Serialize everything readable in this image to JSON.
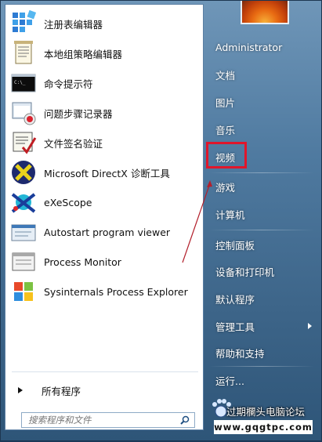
{
  "left_menu": {
    "items": [
      {
        "label": "注册表编辑器",
        "icon": "registry-editor-icon"
      },
      {
        "label": "本地组策略编辑器",
        "icon": "group-policy-icon"
      },
      {
        "label": "命令提示符",
        "icon": "command-prompt-icon"
      },
      {
        "label": "问题步骤记录器",
        "icon": "steps-recorder-icon"
      },
      {
        "label": "文件签名验证",
        "icon": "file-signature-icon"
      },
      {
        "label": "Microsoft DirectX 诊断工具",
        "icon": "directx-icon"
      },
      {
        "label": "eXeScope",
        "icon": "exescope-icon"
      },
      {
        "label": "Autostart program viewer",
        "icon": "autostart-icon"
      },
      {
        "label": "Process Monitor",
        "icon": "process-monitor-icon"
      },
      {
        "label": "Sysinternals Process Explorer",
        "icon": "process-explorer-icon"
      }
    ],
    "all_programs_label": "所有程序",
    "search_placeholder": "搜索程序和文件"
  },
  "right_menu": {
    "items": [
      {
        "label": "Administrator",
        "has_arrow": false
      },
      {
        "label": "文档",
        "has_arrow": false
      },
      {
        "label": "图片",
        "has_arrow": false
      },
      {
        "label": "音乐",
        "has_arrow": false
      },
      {
        "label": "视频",
        "has_arrow": false
      },
      {
        "label": "游戏",
        "has_arrow": false
      },
      {
        "label": "计算机",
        "has_arrow": false
      },
      {
        "label": "控制面板",
        "has_arrow": false
      },
      {
        "label": "设备和打印机",
        "has_arrow": false
      },
      {
        "label": "默认程序",
        "has_arrow": false
      },
      {
        "label": "管理工具",
        "has_arrow": true
      },
      {
        "label": "帮助和支持",
        "has_arrow": false
      },
      {
        "label": "运行...",
        "has_arrow": false
      }
    ],
    "highlighted_item": "视频"
  },
  "watermark": {
    "text": "过期欄头电脑论坛",
    "url": "www.gqgtpc.com"
  },
  "colors": {
    "highlight": "#e0162b",
    "pointer_line": "#b3202c",
    "menu_glass": "#4f7aa0"
  }
}
